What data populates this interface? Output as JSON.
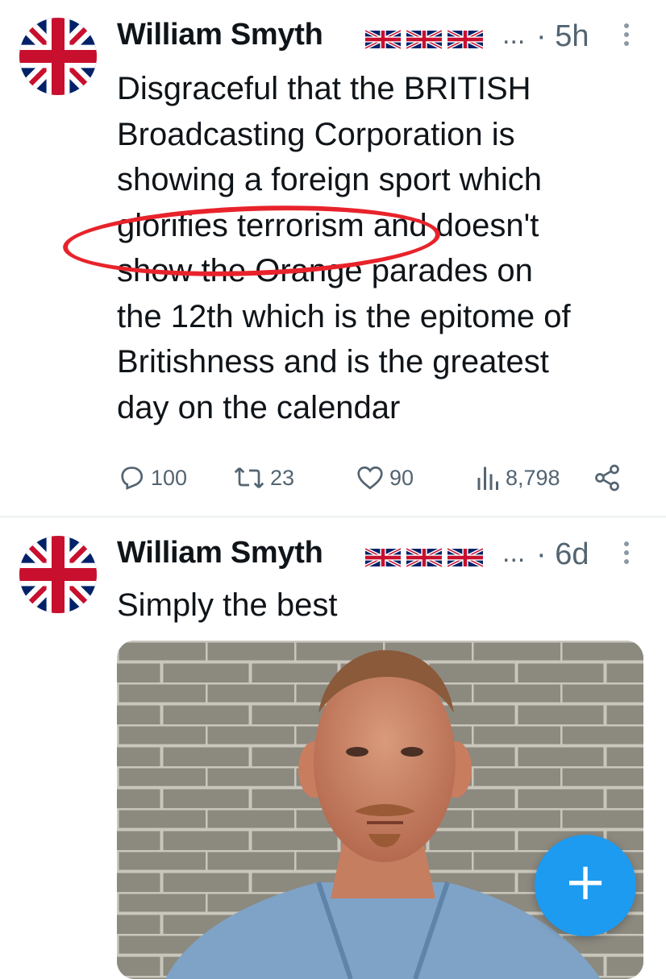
{
  "tweets": [
    {
      "author_name": "William Smyth",
      "flags_count": 3,
      "ellipsis": "...",
      "time": "· 5h",
      "text_lines": [
        "Disgraceful that the BRITISH",
        "Broadcasting Corporation is",
        "showing a foreign sport which",
        "glorifies terrorism and doesn't",
        "show the Orange parades on",
        "the 12th which is the epitome of",
        "Britishness and is the greatest",
        "day on the calendar"
      ],
      "replies": "100",
      "reposts": "23",
      "likes": "90",
      "views": "8,798"
    },
    {
      "author_name": "William Smyth",
      "ellipsis": "...",
      "time": "· 6d",
      "text": "Simply the best"
    }
  ],
  "annotation_color": "#e8232b",
  "accent_color": "#1d9bf0",
  "fab_label": "+"
}
